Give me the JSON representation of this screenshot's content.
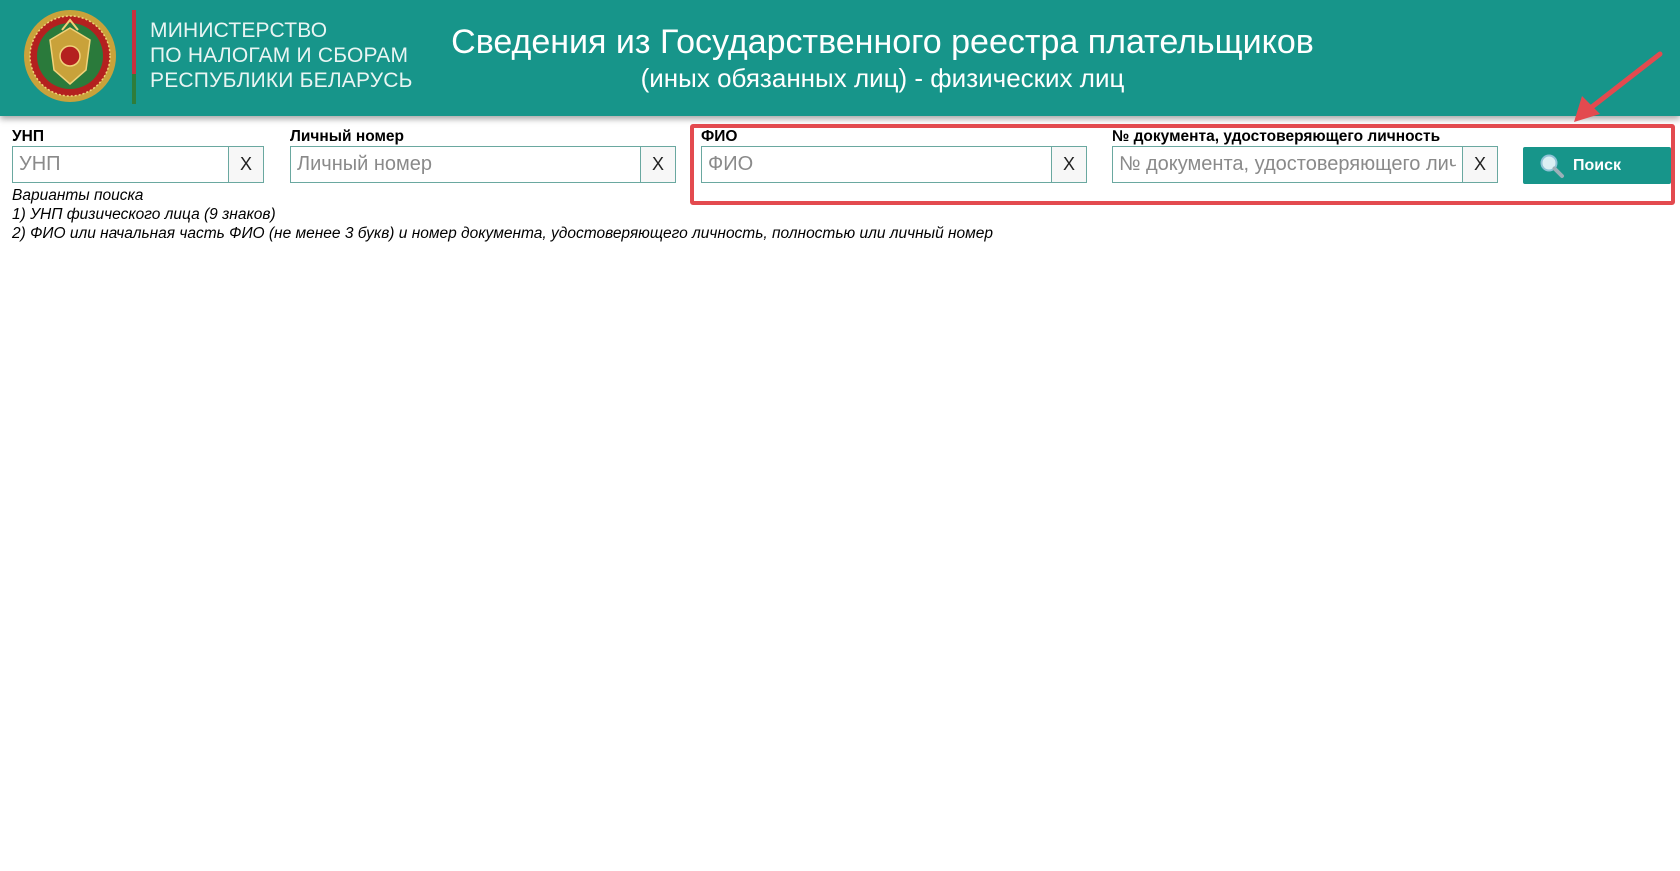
{
  "header": {
    "org_lines": [
      "МИНИСТЕРСТВО",
      "ПО НАЛОГАМ И СБОРАМ",
      "РЕСПУБЛИКИ БЕЛАРУСЬ"
    ],
    "title_line1": "Сведения из Государственного реестра плательщиков",
    "title_line2": "(иных обязанных лиц) - физических лиц",
    "bg_color": "#17958a"
  },
  "form": {
    "unp": {
      "label": "УНП",
      "placeholder": "УНП",
      "value": "",
      "clear": "X"
    },
    "personal": {
      "label": "Личный номер",
      "placeholder": "Личный номер",
      "value": "",
      "clear": "X"
    },
    "fio": {
      "label": "ФИО",
      "placeholder": "ФИО",
      "value": "",
      "clear": "X"
    },
    "doc": {
      "label": "№ документа, удостоверяющего личность",
      "placeholder": "№ документа, удостоверяющего личность",
      "value": "",
      "clear": "X"
    },
    "search_label": "Поиск"
  },
  "hints": {
    "title": "Варианты поиска",
    "line1": "1) УНП физического лица (9 знаков)",
    "line2": "2) ФИО или начальная часть ФИО (не менее 3 букв) и номер документа, удостоверяющего личность, полностью или личный номер"
  },
  "annotation": {
    "color": "#e34a4f"
  },
  "icons": {
    "emblem": "ministry-emblem-icon",
    "search": "magnifier-icon",
    "arrow": "red-arrow-icon"
  }
}
